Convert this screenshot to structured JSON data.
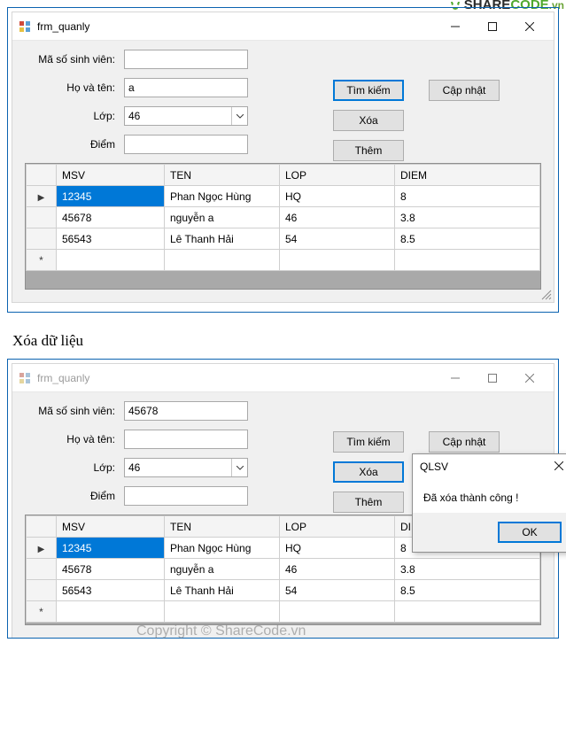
{
  "watermark_logo": {
    "text1": "SHARE",
    "text2": "CODE",
    "suffix": ".vn"
  },
  "caption_between": "Xóa dữ liệu",
  "watermark_center1": "ShareCode.vn",
  "watermark_center2": "Copyright © ShareCode.vn",
  "window1": {
    "title": "frm_quanly",
    "labels": {
      "msv": "Mã số sinh viên:",
      "hoten": "Họ và tên:",
      "lop": "Lớp:",
      "diem": "Điểm"
    },
    "values": {
      "msv": "",
      "hoten": "a",
      "lop": "46",
      "diem": ""
    },
    "buttons": {
      "tim": "Tìm kiếm",
      "xoa": "Xóa",
      "them": "Thêm",
      "capnhat": "Cập nhật"
    },
    "grid": {
      "headers": [
        "MSV",
        "TEN",
        "LOP",
        "DIEM"
      ],
      "rows": [
        {
          "sel": true,
          "cells": [
            "12345",
            "Phan Ngọc Hùng",
            "HQ",
            "8"
          ]
        },
        {
          "sel": false,
          "cells": [
            "45678",
            "nguyễn a",
            "46",
            "3.8"
          ]
        },
        {
          "sel": false,
          "cells": [
            "56543",
            "Lê Thanh Hải",
            "54",
            "8.5"
          ]
        }
      ],
      "newrow_marker": "*",
      "rowptr_marker": "▶"
    }
  },
  "window2": {
    "title": "frm_quanly",
    "labels": {
      "msv": "Mã số sinh viên:",
      "hoten": "Họ và tên:",
      "lop": "Lớp:",
      "diem": "Điểm"
    },
    "values": {
      "msv": "45678",
      "hoten": "",
      "lop": "46",
      "diem": ""
    },
    "buttons": {
      "tim": "Tìm kiếm",
      "xoa": "Xóa",
      "them": "Thêm",
      "capnhat": "Cập nhật"
    },
    "grid": {
      "headers": [
        "MSV",
        "TEN",
        "LOP",
        "DIEM"
      ],
      "rows": [
        {
          "sel": true,
          "cells": [
            "12345",
            "Phan Ngọc Hùng",
            "HQ",
            "8"
          ]
        },
        {
          "sel": false,
          "cells": [
            "45678",
            "nguyễn a",
            "46",
            "3.8"
          ]
        },
        {
          "sel": false,
          "cells": [
            "56543",
            "Lê Thanh Hải",
            "54",
            "8.5"
          ]
        }
      ],
      "newrow_marker": "*",
      "rowptr_marker": "▶"
    },
    "msgbox": {
      "title": "QLSV",
      "message": "Đã xóa thành công !",
      "ok": "OK"
    }
  }
}
